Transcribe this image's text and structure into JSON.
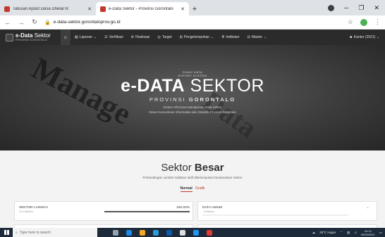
{
  "browser": {
    "tabs": [
      {
        "title": "Tatusan Apoot Desa Dhelal N:",
        "active": false,
        "favicon_color": "#c0392b"
      },
      {
        "title": "e-Data Sektor - Provinsi Gorontalo",
        "active": true,
        "favicon_color": "#c0392b"
      }
    ],
    "new_tab": "+",
    "url": "e-data-sektor.gorontaloprov.go.id"
  },
  "site": {
    "logo": {
      "bold": "e-Data",
      "light": "Sektor",
      "sub": "PROVINSI GORONTALO"
    },
    "menu": [
      {
        "label": "Laporan",
        "icon": "file-icon",
        "dropdown": true
      },
      {
        "label": "Verifikasi",
        "icon": "check-list-icon",
        "dropdown": false
      },
      {
        "label": "Realisasi",
        "icon": "gear-icon",
        "dropdown": false
      },
      {
        "label": "Target",
        "icon": "target-icon",
        "dropdown": false
      },
      {
        "label": "Pengelompokan",
        "icon": "group-icon",
        "dropdown": true
      },
      {
        "label": "Indikator",
        "icon": "list-icon",
        "dropdown": false
      },
      {
        "label": "Master",
        "icon": "grid-icon",
        "dropdown": true
      }
    ],
    "user": "Kantor (2021)"
  },
  "hero": {
    "badge_line1": "DINAS DATA",
    "badge_line2": "EXPORT SYSTEM",
    "title_bold": "e-DATA",
    "title_light": "SEKTOR",
    "province_light": "PROVINSI",
    "province_bold": "GORONTALO",
    "desc1": "Sistem Informasi Manajemen Data Sektor",
    "desc2": "Dinas Komunikasi Informatika dan Statistik Provinsi Gorontalo",
    "watermark1": "Manage",
    "watermark2": "Data"
  },
  "section": {
    "title_light": "Sektor",
    "title_bold": "Besar",
    "subtitle": "Perbandingan Jumlah Indikator aktif dikelompokan berdasarkan Sektor",
    "toggle_normal": "Normal",
    "toggle_grafik": "Grafik",
    "cards": [
      {
        "name": "SEKTOR LAINNYA",
        "count": "12 Indikator",
        "percent": "100,00%",
        "fill": 1.0
      },
      {
        "name": "DATA UMUM",
        "count": "- Indikator",
        "percent": "",
        "fill": 0.0
      }
    ]
  },
  "taskbar": {
    "search_placeholder": "Type here to search",
    "weather": "29°C Hujan",
    "time": "14:13",
    "date": "09/09/2021"
  }
}
